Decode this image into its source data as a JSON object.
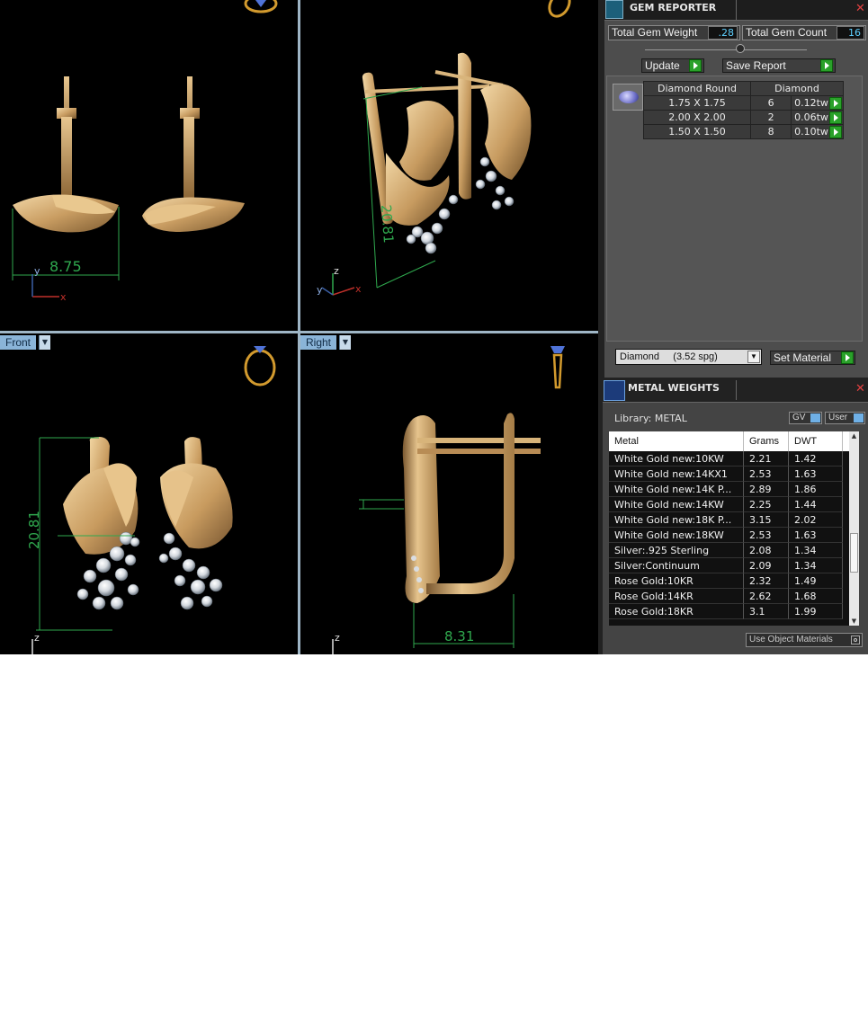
{
  "viewports": {
    "top_left": {
      "dim_label": "8.75",
      "axis_y": "y",
      "axis_x": "x"
    },
    "top_right": {
      "dim_label": "20.81",
      "axis_z": "z",
      "axis_y": "y",
      "axis_x": "x"
    },
    "bottom_left": {
      "view_label": "Front",
      "dim_label": "20.81",
      "axis_z": "z"
    },
    "bottom_right": {
      "view_label": "Right",
      "dim_label": "8.31",
      "axis_z": "z"
    }
  },
  "gem_reporter": {
    "title": "GEM REPORTER",
    "total_gem_weight_label": "Total Gem Weight",
    "total_gem_weight_value": ".28",
    "total_gem_count_label": "Total Gem Count",
    "total_gem_count_value": "16",
    "update_label": "Update",
    "save_report_label": "Save Report",
    "table_headers": {
      "shape": "Diamond Round",
      "material": "Diamond"
    },
    "rows": [
      {
        "size": "1.75 X 1.75",
        "count": "6",
        "weight": "0.12tw"
      },
      {
        "size": "2.00 X 2.00",
        "count": "2",
        "weight": "0.06tw"
      },
      {
        "size": "1.50 X 1.50",
        "count": "8",
        "weight": "0.10tw"
      }
    ],
    "material_select": "Diamond     (3.52 spg)",
    "set_material_label": "Set Material"
  },
  "metal_weights": {
    "title": "METAL WEIGHTS",
    "library_label": "Library: METAL",
    "gv_label": "GV",
    "user_label": "User",
    "headers": {
      "metal": "Metal",
      "grams": "Grams",
      "dwt": "DWT"
    },
    "rows": [
      {
        "metal": "White Gold new:10KW",
        "grams": "2.21",
        "dwt": "1.42"
      },
      {
        "metal": "White Gold new:14KX1",
        "grams": "2.53",
        "dwt": "1.63"
      },
      {
        "metal": "White Gold new:14K P...",
        "grams": "2.89",
        "dwt": "1.86"
      },
      {
        "metal": "White Gold new:14KW",
        "grams": "2.25",
        "dwt": "1.44"
      },
      {
        "metal": "White Gold new:18K P...",
        "grams": "3.15",
        "dwt": "2.02"
      },
      {
        "metal": "White Gold new:18KW",
        "grams": "2.53",
        "dwt": "1.63"
      },
      {
        "metal": "Silver:.925 Sterling",
        "grams": "2.08",
        "dwt": "1.34"
      },
      {
        "metal": "Silver:Continuum",
        "grams": "2.09",
        "dwt": "1.34"
      },
      {
        "metal": "Rose Gold:10KR",
        "grams": "2.32",
        "dwt": "1.49"
      },
      {
        "metal": "Rose Gold:14KR",
        "grams": "2.62",
        "dwt": "1.68"
      },
      {
        "metal": "Rose Gold:18KR",
        "grams": "3.1",
        "dwt": "1.99"
      }
    ],
    "use_object_materials_label": "Use Object Materials"
  },
  "colors": {
    "gold": "#c9a268",
    "dimension_green": "#2fa84e",
    "viewport_label_bg": "#8ab4d8",
    "accent_green": "#2aa12a"
  }
}
